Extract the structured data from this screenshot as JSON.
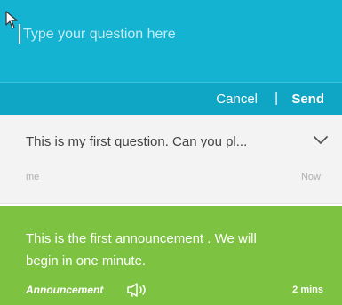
{
  "composer": {
    "placeholder": "Type your question here",
    "cancel_label": "Cancel",
    "separator": "|",
    "send_label": "Send"
  },
  "question": {
    "text": "This is my first question. Can you pl...",
    "author": "me",
    "time": "Now"
  },
  "announcement": {
    "text": "This is the first announcement . We will begin in one minute.",
    "label": "Announcement",
    "time": "2 mins"
  },
  "colors": {
    "composer_bg": "#13b3d1",
    "question_bg": "#f3f3f3",
    "announcement_bg": "#7dc241"
  }
}
